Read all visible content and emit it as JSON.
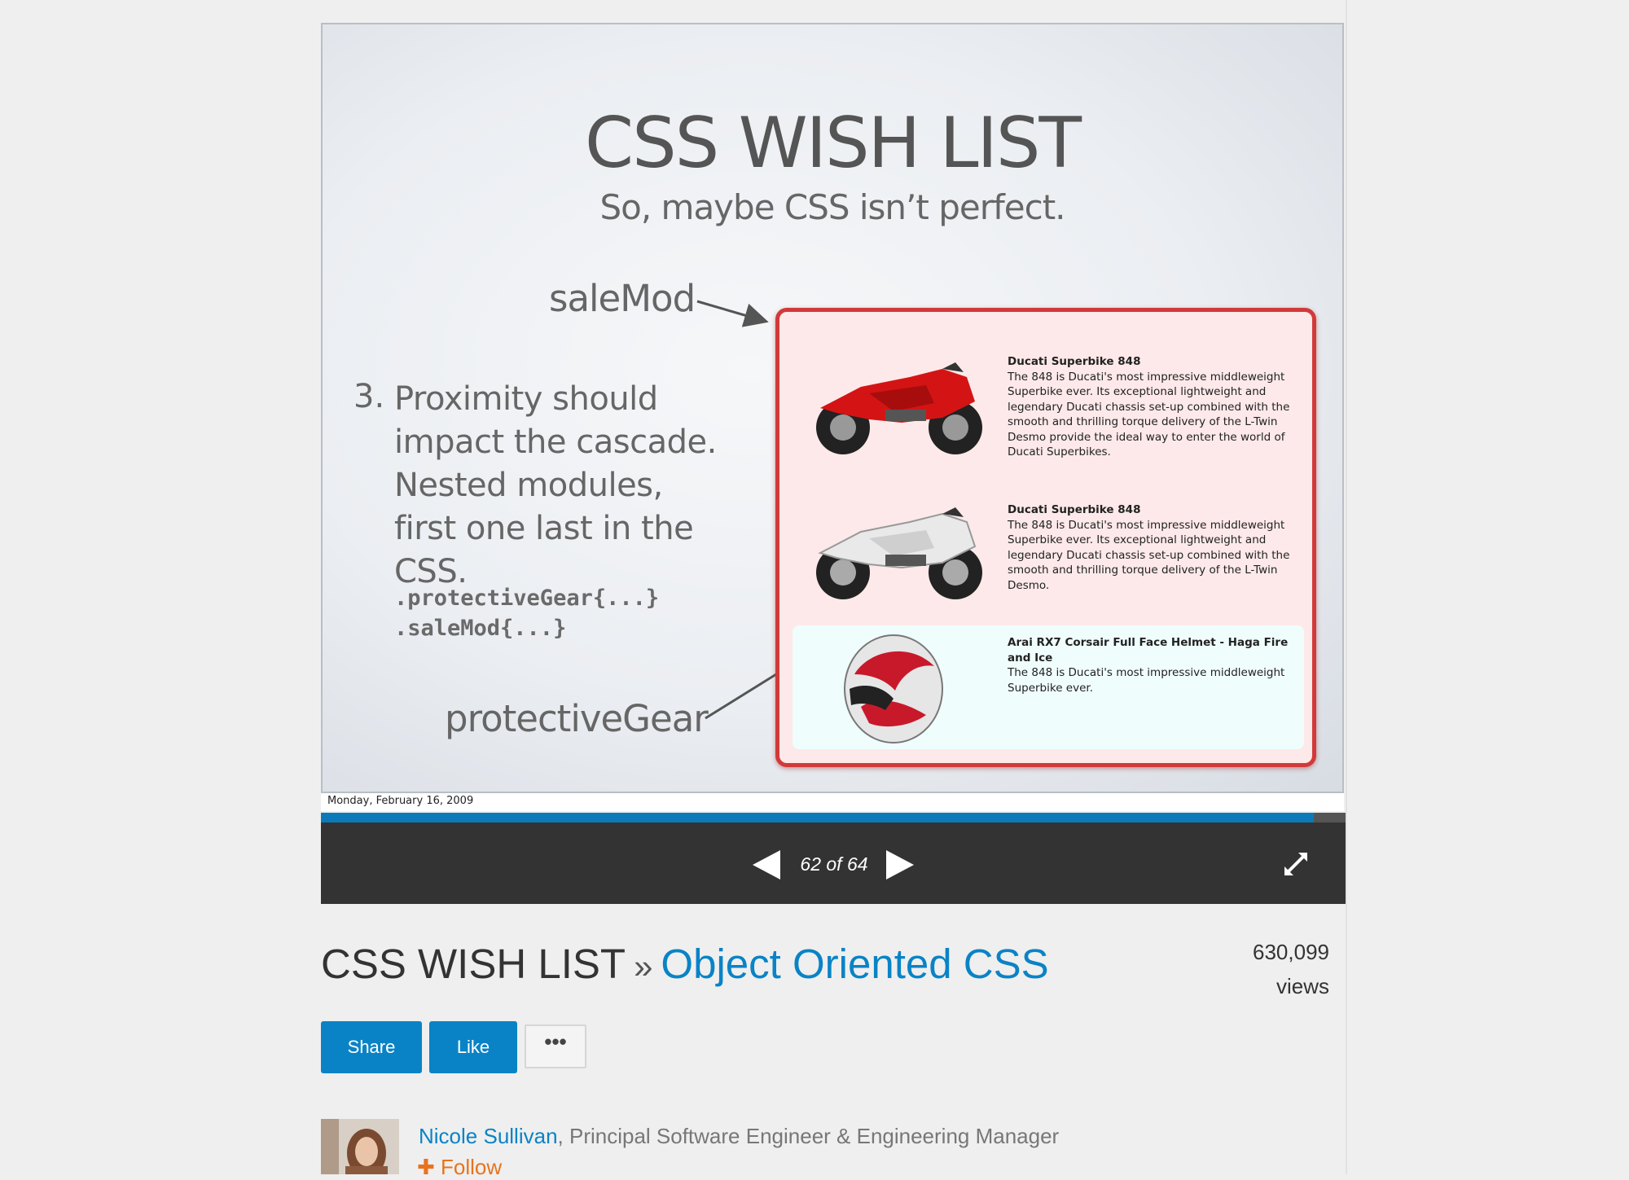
{
  "slide": {
    "title": "CSS WISH LIST",
    "subtitle": "So, maybe CSS isn’t perfect.",
    "label_salemod": "saleMod",
    "label_protective": "protectiveGear",
    "point_number": "3.",
    "point_text": "Proximity should impact the cascade. Nested modules, first one last in the CSS.",
    "code_lines": [
      ".protectiveGear{...}",
      ".saleMod{...}"
    ],
    "products": [
      {
        "name": "Ducati Superbike 848",
        "description": "The 848 is Ducati's most impressive middleweight Superbike ever. Its exceptional lightweight and legendary Ducati chassis set-up combined with the smooth and thrilling torque delivery of the L-Twin Desmo provide the ideal way to enter the world of Ducati Superbikes."
      },
      {
        "name": "Ducati Superbike 848",
        "description": "The 848 is Ducati's most impressive middleweight Superbike ever. Its exceptional lightweight and legendary Ducati chassis set-up combined with the smooth and thrilling torque delivery of the L-Twin Desmo."
      },
      {
        "name": "Arai RX7 Corsair Full Face Helmet - Haga Fire and Ice",
        "description": "The 848 is Ducati's most impressive middleweight Superbike ever."
      }
    ],
    "date": "Monday, February 16, 2009"
  },
  "player": {
    "current_slide": 62,
    "total_slides": 64,
    "counter_text": "62 of 64",
    "colors": {
      "progress": "#0c7ab8",
      "bar": "#333333"
    }
  },
  "presentation": {
    "title": "CSS WISH LIST",
    "separator": "»",
    "deck_link": "Object Oriented CSS",
    "views_count": "630,099",
    "views_label": "views",
    "share_label": "Share",
    "like_label": "Like",
    "more_label": "•••"
  },
  "author": {
    "name": "Nicole Sullivan",
    "role": ", Principal Software Engineer & Engineering Manager",
    "follow_label": "Follow"
  },
  "colors": {
    "accent": "#0a83c6",
    "follow": "#e8731d"
  }
}
